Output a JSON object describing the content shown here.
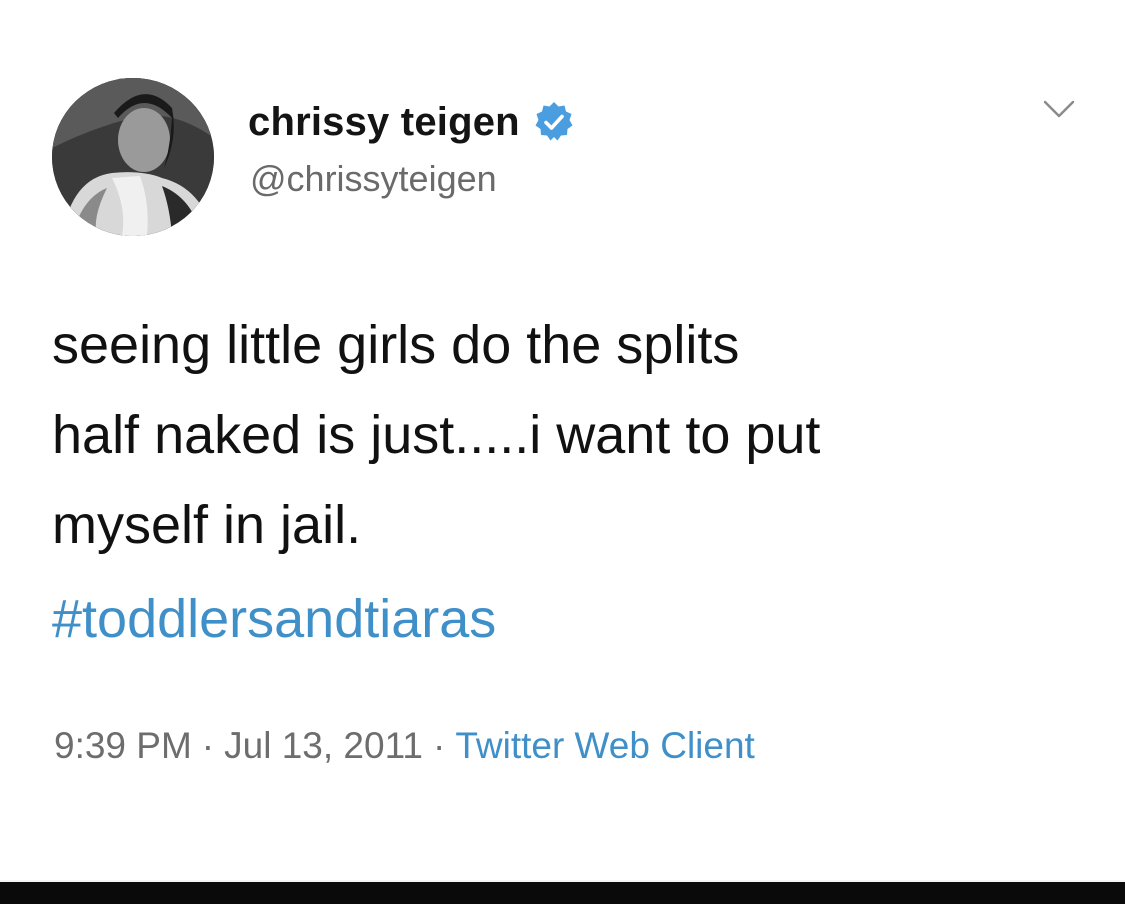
{
  "user": {
    "display_name": "chrissy teigen",
    "handle": "@chrissyteigen",
    "verified": true,
    "avatar_icon": "profile-photo"
  },
  "tweet": {
    "text_lines": [
      "seeing little girls do the splits",
      "half naked is just.....i want to put",
      "myself in jail."
    ],
    "hashtag": "#toddlersandtiaras"
  },
  "meta": {
    "time": "9:39 PM",
    "separator": "·",
    "date": "Jul 13, 2011",
    "source": "Twitter Web Client"
  },
  "icons": {
    "verified": "verified-badge-icon",
    "menu": "chevron-down-icon"
  },
  "colors": {
    "link": "#3f8fc9",
    "verified": "#4a9ee0",
    "text": "#111111",
    "muted": "#6d6d6d"
  }
}
